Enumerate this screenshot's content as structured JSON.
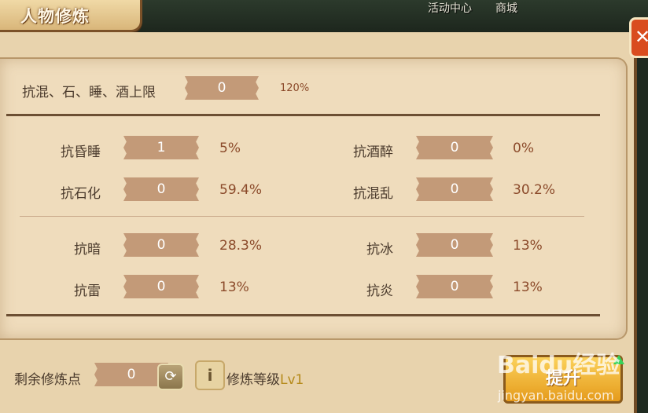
{
  "header": {
    "title": "人物修炼",
    "links": [
      "活动中心",
      "商城"
    ],
    "close_icon": "close-icon"
  },
  "cap": {
    "label": "抗混、石、睡、酒上限",
    "value": "0",
    "percent": "120%"
  },
  "stats_top": [
    {
      "label": "抗昏睡",
      "value": "1",
      "percent": "5%"
    },
    {
      "label": "抗酒醉",
      "value": "0",
      "percent": "0%"
    },
    {
      "label": "抗石化",
      "value": "0",
      "percent": "59.4%"
    },
    {
      "label": "抗混乱",
      "value": "0",
      "percent": "30.2%"
    }
  ],
  "stats_bottom": [
    {
      "label": "抗暗",
      "value": "0",
      "percent": "28.3%"
    },
    {
      "label": "抗冰",
      "value": "0",
      "percent": "13%"
    },
    {
      "label": "抗雷",
      "value": "0",
      "percent": "13%"
    },
    {
      "label": "抗炎",
      "value": "0",
      "percent": "13%"
    }
  ],
  "footer": {
    "remaining_label": "剩余修炼点",
    "remaining_value": "0",
    "info_glyph": "i",
    "level_label": "修炼等级",
    "level_value": "Lv1",
    "upgrade_label": "提升"
  },
  "watermark": {
    "text": "Baidu经验",
    "sub": "jingyan.baidu.com"
  }
}
